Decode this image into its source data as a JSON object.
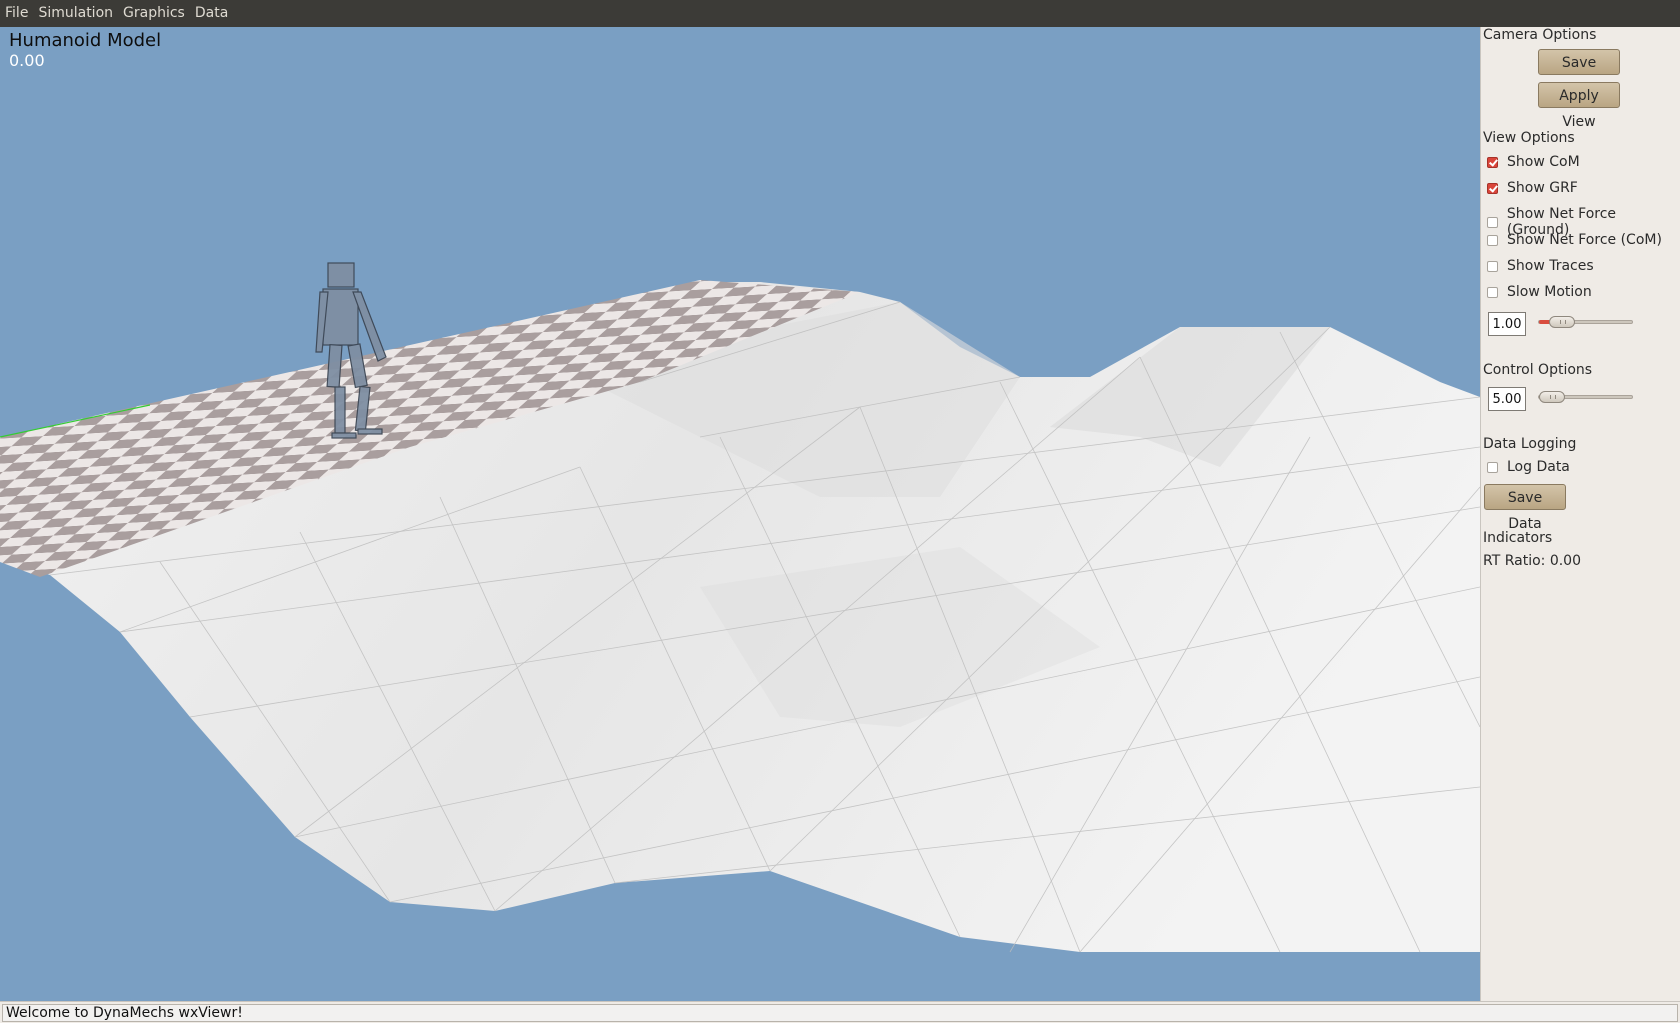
{
  "menubar": {
    "items": [
      "File",
      "Simulation",
      "Graphics",
      "Data"
    ]
  },
  "viewport": {
    "model_title": "Humanoid Model",
    "sim_time": "0.00"
  },
  "panel": {
    "camera_options": {
      "title": "Camera Options",
      "save_view_label": "Save View",
      "apply_view_label": "Apply View"
    },
    "view_options": {
      "title": "View Options",
      "checkboxes": [
        {
          "label": "Show CoM",
          "checked": true
        },
        {
          "label": "Show GRF",
          "checked": true
        },
        {
          "label": "Show Net Force (Ground)",
          "checked": false
        },
        {
          "label": "Show Net Force (CoM)",
          "checked": false
        },
        {
          "label": "Show Traces",
          "checked": false
        },
        {
          "label": "Slow Motion",
          "checked": false
        }
      ],
      "slow_motion_value": "1.00"
    },
    "control_options": {
      "title": "Control Options",
      "value": "5.00"
    },
    "data_logging": {
      "title": "Data Logging",
      "log_data_label": "Log Data",
      "log_data_checked": false,
      "save_data_label": "Save Data"
    },
    "indicators": {
      "title": "Indicators",
      "rt_ratio": "RT Ratio: 0.00"
    }
  },
  "statusbar": {
    "text": "Welcome to DynaMechs wxViewr!"
  },
  "colors": {
    "sky": "#7a9fc3",
    "menubar": "#3c3b37",
    "panel": "#efebe6",
    "accent": "#d94c3e"
  }
}
